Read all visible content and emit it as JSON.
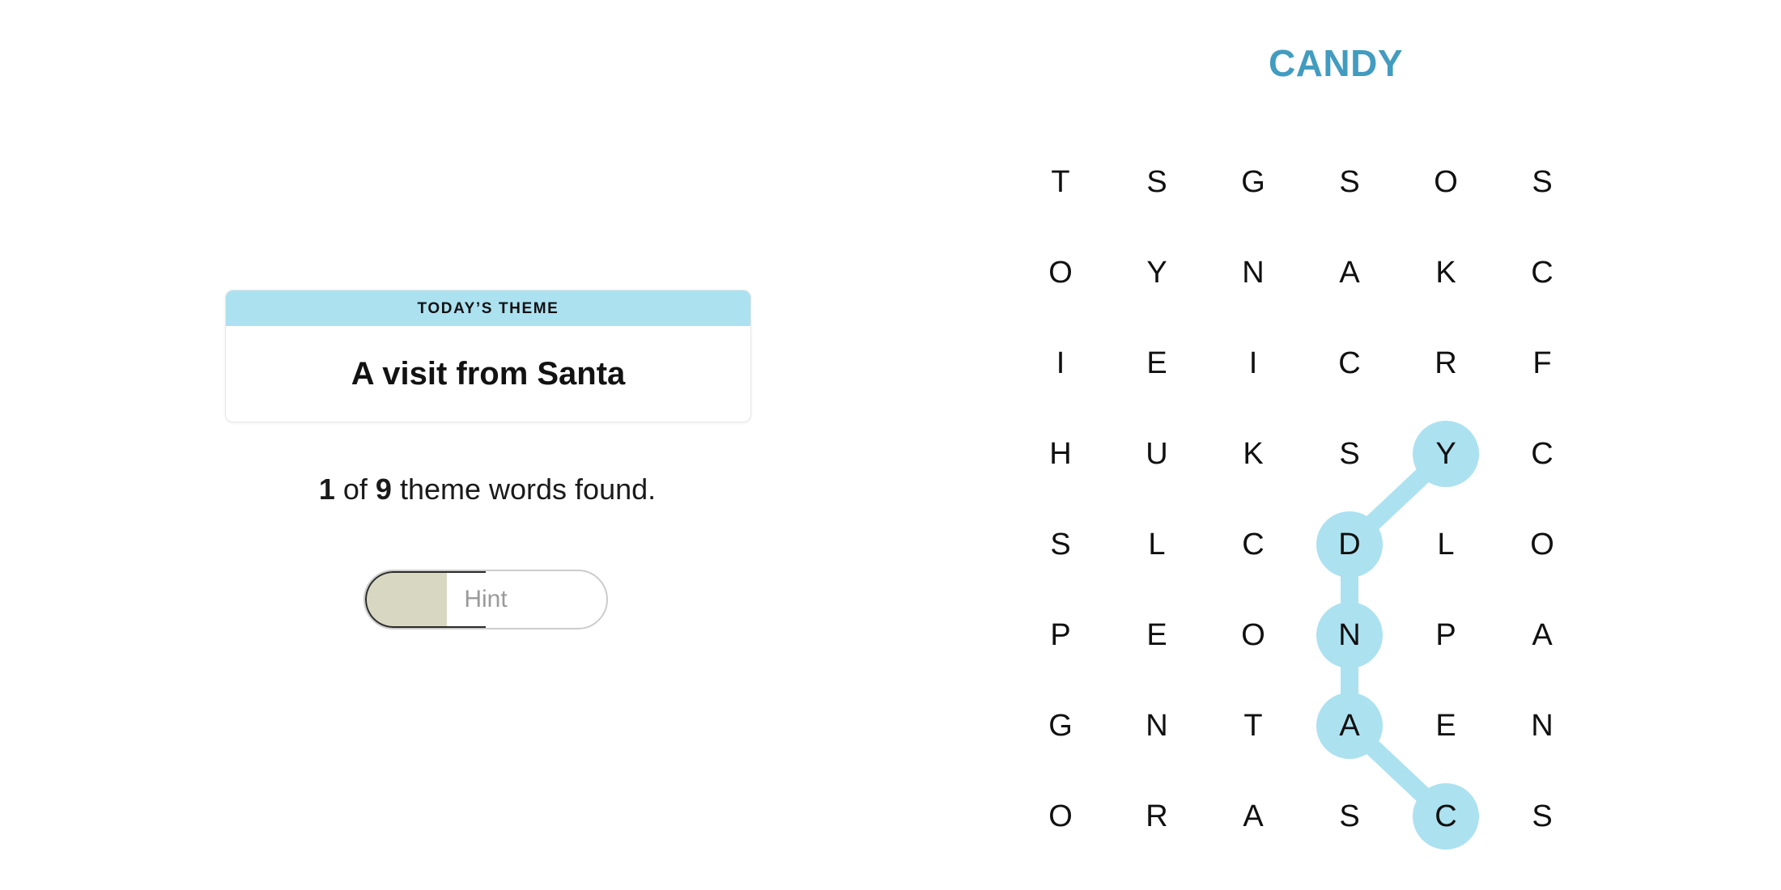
{
  "puzzle": {
    "title": "CANDY",
    "title_color": "#429cc0",
    "highlight_color": "#ace1f0",
    "grid": {
      "rows": 8,
      "cols": 6,
      "letters": [
        [
          "T",
          "S",
          "G",
          "S",
          "O",
          "S"
        ],
        [
          "O",
          "Y",
          "N",
          "A",
          "K",
          "C"
        ],
        [
          "I",
          "E",
          "I",
          "C",
          "R",
          "F"
        ],
        [
          "H",
          "U",
          "K",
          "S",
          "Y",
          "C"
        ],
        [
          "S",
          "L",
          "C",
          "D",
          "L",
          "O"
        ],
        [
          "P",
          "E",
          "O",
          "N",
          "P",
          "A"
        ],
        [
          "G",
          "N",
          "T",
          "A",
          "E",
          "N"
        ],
        [
          "O",
          "R",
          "A",
          "S",
          "C",
          "S"
        ]
      ]
    },
    "found_word": {
      "word": "CANDY",
      "cells": [
        {
          "row": 7,
          "col": 4,
          "letter": "C"
        },
        {
          "row": 6,
          "col": 3,
          "letter": "A"
        },
        {
          "row": 5,
          "col": 3,
          "letter": "N"
        },
        {
          "row": 4,
          "col": 3,
          "letter": "D"
        },
        {
          "row": 3,
          "col": 4,
          "letter": "Y"
        }
      ]
    }
  },
  "theme_card": {
    "header_label": "TODAY’S THEME",
    "theme_title": "A visit from Santa",
    "header_bg": "#ace1f0"
  },
  "progress": {
    "found_count": "1",
    "connector_of": " of ",
    "total_count": "9",
    "suffix": " theme words found."
  },
  "hint_button": {
    "label": "Hint",
    "fill_percent": "34",
    "fill_color": "#d8d7c2"
  }
}
